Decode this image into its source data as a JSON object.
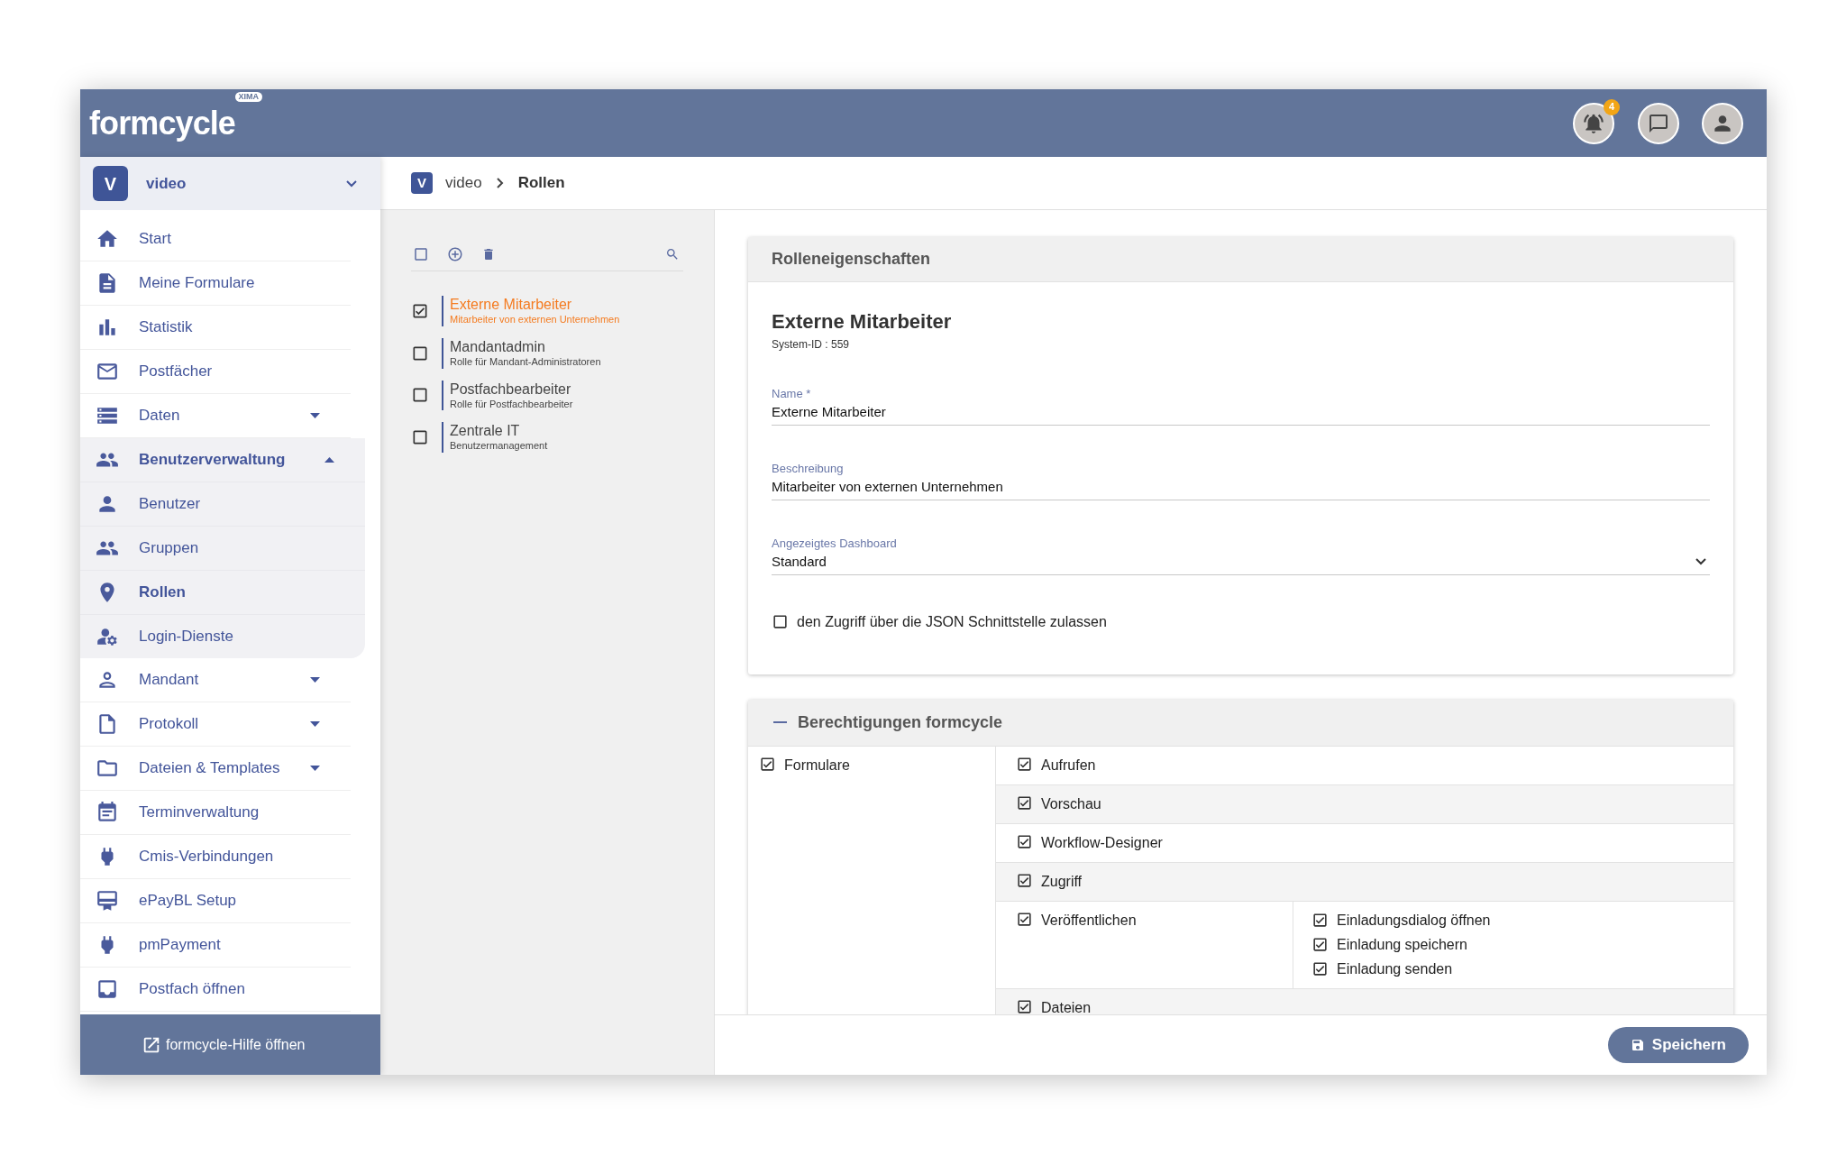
{
  "header": {
    "logo": "formcycle",
    "logo_badge": "XIMA",
    "notification_count": "4"
  },
  "sidebar": {
    "client": {
      "initial": "V",
      "name": "video"
    },
    "items": [
      {
        "kind": "link",
        "label": "Start",
        "selected": false
      },
      {
        "kind": "link",
        "label": "Meine Formulare",
        "selected": false
      },
      {
        "kind": "link",
        "label": "Statistik",
        "selected": false
      },
      {
        "kind": "link",
        "label": "Postfächer",
        "selected": false
      },
      {
        "kind": "group",
        "label": "Daten",
        "selected": false,
        "expanded": false
      },
      {
        "kind": "group",
        "label": "Benutzerverwaltung",
        "selected": true,
        "expanded": true,
        "children": [
          {
            "label": "Benutzer",
            "selected": false
          },
          {
            "label": "Gruppen",
            "selected": false
          },
          {
            "label": "Rollen",
            "selected": true
          },
          {
            "label": "Login-Dienste",
            "selected": false
          }
        ]
      },
      {
        "kind": "group",
        "label": "Mandant",
        "selected": false,
        "expanded": false
      },
      {
        "kind": "group",
        "label": "Protokoll",
        "selected": false,
        "expanded": false
      },
      {
        "kind": "group",
        "label": "Dateien & Templates",
        "selected": false,
        "expanded": false
      },
      {
        "kind": "link",
        "label": "Terminverwaltung",
        "selected": false
      },
      {
        "kind": "link",
        "label": "Cmis-Verbindungen",
        "selected": false
      },
      {
        "kind": "link",
        "label": "ePayBL Setup",
        "selected": false
      },
      {
        "kind": "link",
        "label": "pmPayment",
        "selected": false
      },
      {
        "kind": "link",
        "label": "Postfach öffnen",
        "selected": false
      }
    ],
    "help_link": "formcycle-Hilfe öffnen"
  },
  "breadcrumb": {
    "initial": "V",
    "items": [
      "video",
      "Rollen"
    ]
  },
  "roles_toolbar": {
    "select_all_checked": false
  },
  "roles": [
    {
      "name": "Externe Mitarbeiter",
      "description": "Mitarbeiter von externen Unternehmen",
      "checked": true,
      "selected": true
    },
    {
      "name": "Mandantadmin",
      "description": "Rolle für Mandant-Administratoren",
      "checked": false,
      "selected": false
    },
    {
      "name": "Postfachbearbeiter",
      "description": "Rolle für Postfachbearbeiter",
      "checked": false,
      "selected": false
    },
    {
      "name": "Zentrale IT",
      "description": "Benutzermanagement",
      "checked": false,
      "selected": false
    }
  ],
  "properties": {
    "title": "Rolleneigenschaften",
    "role_name": "Externe Mitarbeiter",
    "system_id": "System-ID : 559",
    "fields": [
      {
        "kind": "text",
        "label": "Name *",
        "value": "Externe Mitarbeiter"
      },
      {
        "kind": "text",
        "label": "Beschreibung",
        "value": "Mitarbeiter von externen Unternehmen"
      },
      {
        "kind": "select",
        "label": "Angezeigtes Dashboard",
        "value": "Standard"
      }
    ],
    "json_access": {
      "label": "den Zugriff über die JSON Schnittstelle zulassen",
      "checked": false
    }
  },
  "permissions": {
    "title": "Berechtigungen formcycle",
    "expanded": true,
    "groups": [
      {
        "label": "Formulare",
        "checked": true,
        "permissions": [
          {
            "label": "Aufrufen",
            "checked": true
          },
          {
            "label": "Vorschau",
            "checked": true
          },
          {
            "label": "Workflow-Designer",
            "checked": true
          },
          {
            "label": "Zugriff",
            "checked": true
          },
          {
            "label": "Veröffentlichen",
            "checked": true,
            "children": [
              {
                "label": "Einladungsdialog öffnen",
                "checked": true
              },
              {
                "label": "Einladung speichern",
                "checked": true
              },
              {
                "label": "Einladung senden",
                "checked": true
              }
            ]
          },
          {
            "label": "Dateien",
            "checked": true
          }
        ]
      }
    ]
  },
  "save_button": "Speichern"
}
